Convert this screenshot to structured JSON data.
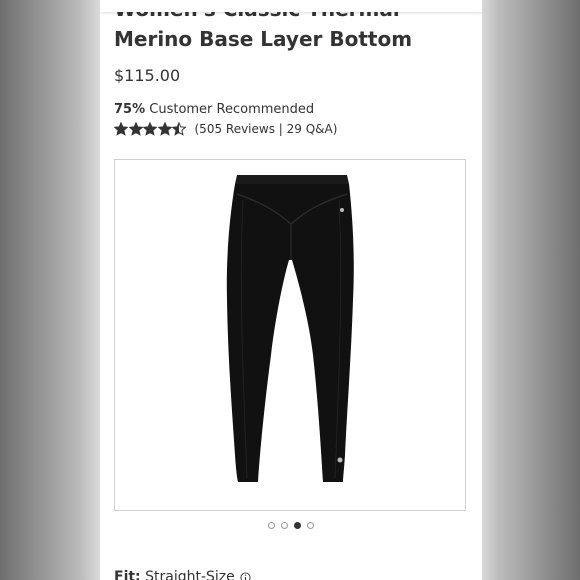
{
  "product": {
    "title_line1": "Women's Classic Thermal",
    "title_line2": "Merino Base Layer Bottom",
    "price": "$115.00",
    "recommend_pct": "75%",
    "recommend_text": " Customer Recommended",
    "rating": {
      "stars": 4.5,
      "max": 5
    },
    "reviews_text": "(505 Reviews | 29 Q&A)",
    "image_icon": "black-leggings-image"
  },
  "carousel": {
    "total": 4,
    "active_index": 3
  },
  "fit": {
    "label": "Fit:",
    "value": "Straight-Size"
  },
  "colors": {
    "text": "#333333",
    "star": "#333333",
    "product": "#111111"
  }
}
